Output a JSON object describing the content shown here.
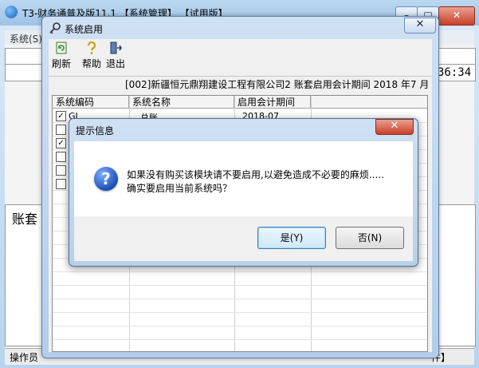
{
  "main_window": {
    "title": "T3-财务通普及版11.1 【系统管理】 【试用版】",
    "minimize": "–",
    "maximize": "□",
    "close": "✕",
    "menu_system": "系统(S)",
    "clock": "36:34",
    "lower_label": "账套",
    "status_left": "操作员",
    "status_right": "件】"
  },
  "sys_window": {
    "title": "系统启用",
    "close": "✕",
    "toolbar": {
      "refresh": "刷新",
      "help": "帮助",
      "exit": "退出"
    },
    "info": "[002]新疆恒元鼎翔建设工程有限公司2 账套启用会计期间 2018 年7 月",
    "columns": [
      "系统编码",
      "系统名称",
      "启用会计期间"
    ],
    "rows": [
      {
        "checked": true,
        "code": "GL",
        "name": "总账",
        "period": "2018-07"
      },
      {
        "checked": false,
        "code": "",
        "name": "",
        "period": ""
      },
      {
        "checked": true,
        "code": "",
        "name": "",
        "period": ""
      },
      {
        "checked": false,
        "code": "",
        "name": "",
        "period": ""
      },
      {
        "checked": false,
        "code": "",
        "name": "",
        "period": ""
      },
      {
        "checked": false,
        "code": "",
        "name": "",
        "period": ""
      }
    ]
  },
  "dialog": {
    "title": "提示信息",
    "close": "✕",
    "message_line1": "如果没有购买该模块请不要启用,以避免造成不必要的麻烦.....",
    "message_line2": "确实要启用当前系统吗？",
    "yes": "是(Y)",
    "no": "否(N)"
  },
  "icons": {
    "app": "app-icon",
    "sys_window": "key-icon",
    "refresh": "refresh-icon",
    "help": "help-icon",
    "exit": "exit-icon",
    "dialog": "question-icon"
  }
}
